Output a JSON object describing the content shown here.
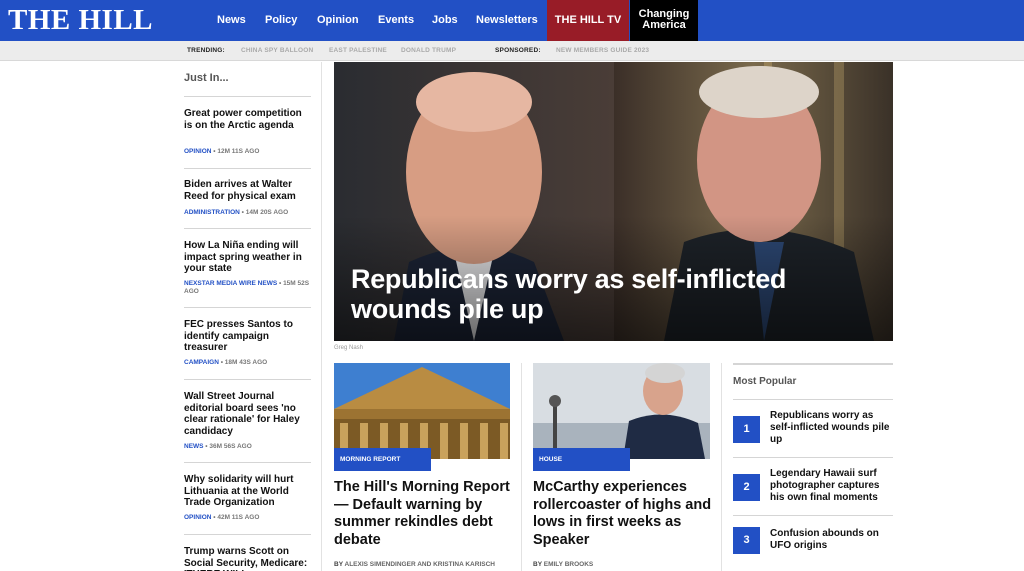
{
  "header": {
    "logo": "THE HILL",
    "nav": [
      "News",
      "Policy",
      "Opinion",
      "Events",
      "Jobs",
      "Newsletters"
    ],
    "tv_label": "THE HILL TV",
    "changing_america": [
      "Changing",
      "America"
    ],
    "colors": {
      "brand_blue": "#2250c5",
      "tv_red": "#981c27"
    }
  },
  "trending": {
    "label": "TRENDING:",
    "items": [
      "CHINA SPY BALLOON",
      "EAST PALESTINE",
      "DONALD TRUMP"
    ],
    "sponsored_label": "SPONSORED:",
    "sponsored_item": "NEW MEMBERS GUIDE 2023"
  },
  "just_in": {
    "heading": "Just In...",
    "items": [
      {
        "title": "Great power competition is on the Arctic agenda",
        "category": "OPINION",
        "time": "12M 11S AGO"
      },
      {
        "title": "Biden arrives at Walter Reed for physical exam",
        "category": "ADMINISTRATION",
        "time": "14M 20S AGO"
      },
      {
        "title": "How La Niña ending will impact spring weather in your state",
        "category": "NEXSTAR MEDIA WIRE NEWS",
        "time": "15M 52S AGO"
      },
      {
        "title": "FEC presses Santos to identify campaign treasurer",
        "category": "CAMPAIGN",
        "time": "18M 43S AGO"
      },
      {
        "title": "Wall Street Journal editorial board sees 'no clear rationale' for Haley candidacy",
        "category": "NEWS",
        "time": "36M 56S AGO"
      },
      {
        "title": "Why solidarity will hurt Lithuania at the World Trade Organization",
        "category": "OPINION",
        "time": "42M 11S AGO"
      },
      {
        "title": "Trump warns Scott on Social Security, Medicare: 'THERE WILL",
        "category": "",
        "time": ""
      }
    ]
  },
  "hero": {
    "title": "Republicans worry as self-inflicted wounds pile up",
    "credit": "Greg Nash"
  },
  "articles": [
    {
      "tag": "MORNING REPORT",
      "title": "The Hill's Morning Report — Default warning by summer rekindles debt debate",
      "byline_prefix": "BY",
      "authors": "ALEXIS SIMENDINGER AND KRISTINA KARISCH"
    },
    {
      "tag": "HOUSE",
      "title": "McCarthy experiences rollercoaster of highs and lows in first weeks as Speaker",
      "byline_prefix": "BY",
      "authors": "EMILY BROOKS"
    }
  ],
  "most_popular": {
    "heading": "Most Popular",
    "items": [
      {
        "rank": "1",
        "title": "Republicans worry as self-inflicted wounds pile up"
      },
      {
        "rank": "2",
        "title": "Legendary Hawaii surf photographer captures his own final moments"
      },
      {
        "rank": "3",
        "title": "Confusion abounds on UFO origins"
      }
    ]
  }
}
